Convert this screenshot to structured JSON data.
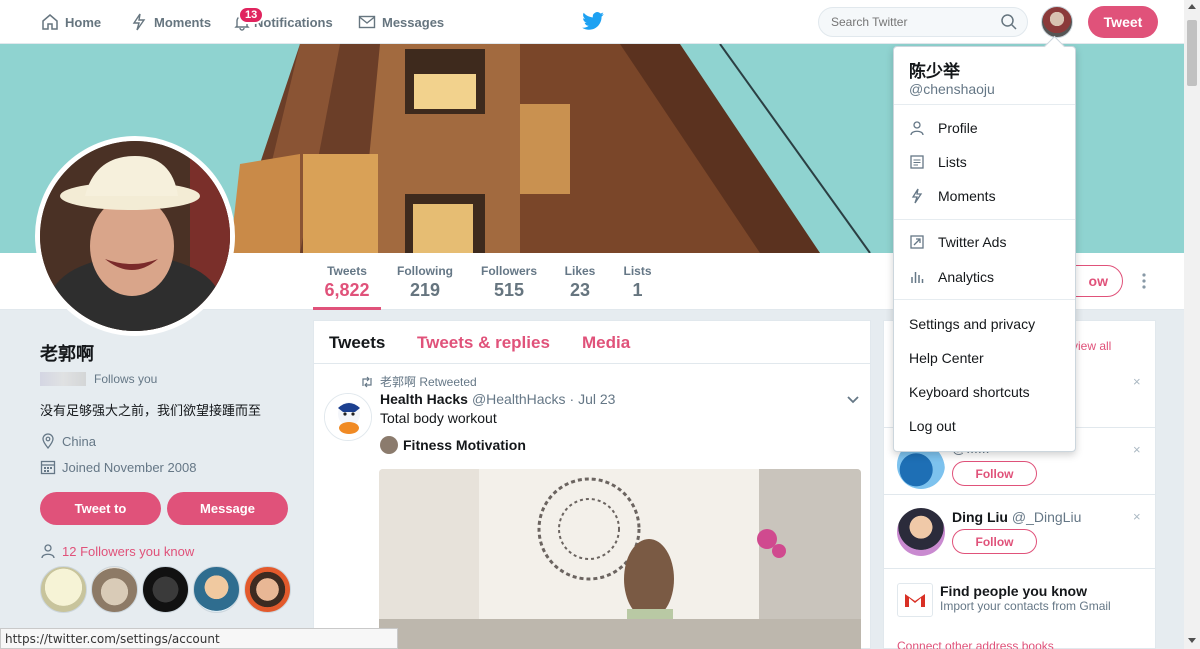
{
  "nav": {
    "home": "Home",
    "moments": "Moments",
    "notifications": "Notifications",
    "notifications_count": "13",
    "messages": "Messages",
    "search_placeholder": "Search Twitter",
    "tweet_button": "Tweet"
  },
  "profile_nav": {
    "stats": [
      {
        "label": "Tweets",
        "value": "6,822"
      },
      {
        "label": "Following",
        "value": "219"
      },
      {
        "label": "Followers",
        "value": "515"
      },
      {
        "label": "Likes",
        "value": "23"
      },
      {
        "label": "Lists",
        "value": "1"
      }
    ],
    "follow_button_partial": "ow"
  },
  "profile": {
    "name": "老郭啊",
    "follows_you": "Follows you",
    "bio": "没有足够强大之前，我们欲望接踵而至",
    "location": "China",
    "joined": "Joined November 2008",
    "tweet_to": "Tweet to",
    "message": "Message",
    "followers_you_know": "12 Followers you know"
  },
  "stream": {
    "tabs": [
      "Tweets",
      "Tweets & replies",
      "Media"
    ],
    "retweet_by": "老郭啊 Retweeted",
    "tweet": {
      "name": "Health Hacks",
      "handle": "@HealthHacks",
      "date": "· Jul 23",
      "text": "Total body workout",
      "card_title": "Fitness Motivation"
    }
  },
  "who_to_follow": {
    "view_all": "view all",
    "items": [
      {
        "name": "",
        "handle": "@......",
        "follow": "Follow"
      },
      {
        "name": "Ding Liu",
        "handle": "@_DingLiu",
        "follow": "Follow"
      }
    ],
    "find_title": "Find people you know",
    "find_sub": "Import your contacts from Gmail",
    "connect": "Connect other address books"
  },
  "dropdown": {
    "name": "陈少举",
    "handle": "@chenshaoju",
    "items": [
      {
        "label": "Profile",
        "icon": "person-icon"
      },
      {
        "label": "Lists",
        "icon": "lists-icon"
      },
      {
        "label": "Moments",
        "icon": "lightning-icon"
      },
      {
        "label": "Twitter Ads",
        "icon": "external-arrow-icon"
      },
      {
        "label": "Analytics",
        "icon": "bar-chart-icon"
      },
      {
        "label": "Settings and privacy"
      },
      {
        "label": "Help Center"
      },
      {
        "label": "Keyboard shortcuts"
      },
      {
        "label": "Log out"
      }
    ]
  },
  "status_url": "https://twitter.com/settings/account",
  "colors": {
    "accent": "#e0527a",
    "twitter_blue": "#1da1f2",
    "banner_sky": "#8fd3d0"
  }
}
